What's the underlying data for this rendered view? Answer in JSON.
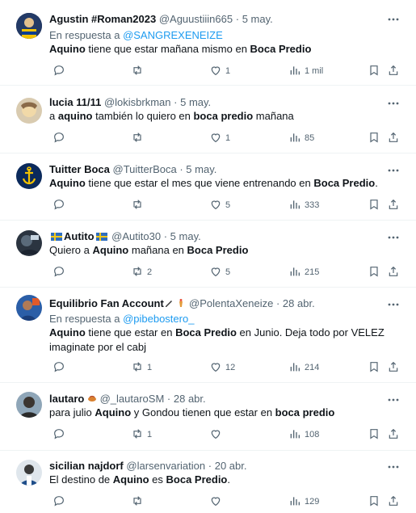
{
  "tweets": [
    {
      "name": "Agustin #Roman2023",
      "handle": "@Aguustiiin665",
      "date": "5 may.",
      "reply_prefix": "En respuesta a ",
      "reply_to": "@SANGREXENEIZE",
      "text": [
        {
          "t": "Aquino",
          "b": true
        },
        {
          "t": " tiene que estar mañana mismo en ",
          "b": false
        },
        {
          "t": "Boca Predio",
          "b": true
        }
      ],
      "replies": "",
      "retweets": "",
      "likes": "1",
      "views": "1 mil"
    },
    {
      "name": "lucia 11/11",
      "handle": "@lokisbrkman",
      "date": "5 may.",
      "text": [
        {
          "t": "a ",
          "b": false
        },
        {
          "t": "aquino",
          "b": true
        },
        {
          "t": " también lo quiero en ",
          "b": false
        },
        {
          "t": "boca predio",
          "b": true
        },
        {
          "t": " mañana",
          "b": false
        }
      ],
      "replies": "",
      "retweets": "",
      "likes": "1",
      "views": "85"
    },
    {
      "name": "Tuitter Boca",
      "handle": "@TuitterBoca",
      "date": "5 may.",
      "text": [
        {
          "t": "Aquino",
          "b": true
        },
        {
          "t": " tiene que estar el mes que viene entrenando en ",
          "b": false
        },
        {
          "t": "Boca Predio",
          "b": true
        },
        {
          "t": ".",
          "b": false
        }
      ],
      "replies": "",
      "retweets": "",
      "likes": "5",
      "views": "333"
    },
    {
      "name": "Autito",
      "handle": "@Autito30",
      "date": "5 may.",
      "text": [
        {
          "t": "Quiero a ",
          "b": false
        },
        {
          "t": "Aquino",
          "b": true
        },
        {
          "t": " mañana en ",
          "b": false
        },
        {
          "t": "Boca Predio",
          "b": true
        }
      ],
      "replies": "",
      "retweets": "2",
      "likes": "5",
      "views": "215"
    },
    {
      "name": "Equilibrio Fan Account",
      "handle": "@PolentaXeneize",
      "date": "28 abr.",
      "reply_prefix": "En respuesta a ",
      "reply_to": "@pibebostero_",
      "text": [
        {
          "t": "Aquino",
          "b": true
        },
        {
          "t": " tiene que estar en ",
          "b": false
        },
        {
          "t": "Boca Predio",
          "b": true
        },
        {
          "t": " en Junio. Deja todo por VELEZ imaginate por el cabj",
          "b": false
        }
      ],
      "replies": "",
      "retweets": "1",
      "likes": "12",
      "views": "214"
    },
    {
      "name": "lautaro",
      "handle": "@_lautaroSM",
      "date": "28 abr.",
      "text": [
        {
          "t": "para julio ",
          "b": false
        },
        {
          "t": "Aquino",
          "b": true
        },
        {
          "t": " y Gondou tienen que estar en ",
          "b": false
        },
        {
          "t": "boca predio",
          "b": true
        }
      ],
      "replies": "",
      "retweets": "1",
      "likes": "",
      "views": "108"
    },
    {
      "name": "sicilian najdorf",
      "handle": "@larsenvariation",
      "date": "20 abr.",
      "text": [
        {
          "t": "El destino de ",
          "b": false
        },
        {
          "t": "Aquino",
          "b": true
        },
        {
          "t": " es ",
          "b": false
        },
        {
          "t": "Boca Predio",
          "b": true
        },
        {
          "t": ".",
          "b": false
        }
      ],
      "replies": "",
      "retweets": "",
      "likes": "",
      "views": "129"
    }
  ],
  "colors": {
    "accent": "#1d9bf0",
    "secondary_text": "#536471",
    "divider": "#eff3f4"
  }
}
